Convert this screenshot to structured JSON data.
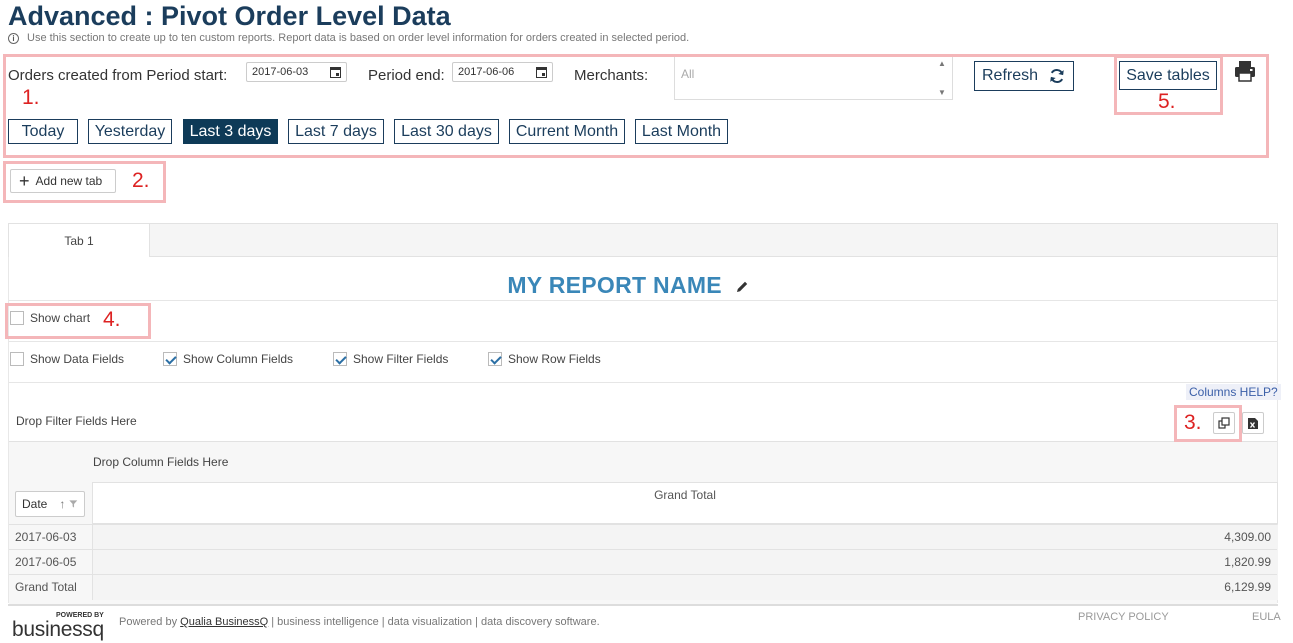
{
  "page": {
    "title": "Advanced : Pivot Order Level Data",
    "subtitle": "Use this section to create up to ten custom reports. Report data is based on order level information for orders created in selected period."
  },
  "filters": {
    "period_start_label": "Orders created from Period start:",
    "period_start_value": "2017-06-03",
    "period_end_label": "Period end:",
    "period_end_value": "2017-06-06",
    "merchants_label": "Merchants:",
    "merchants_value": "All",
    "refresh_label": "Refresh",
    "save_tables_label": "Save tables",
    "quick_ranges": [
      "Today",
      "Yesterday",
      "Last 3 days",
      "Last 7 days",
      "Last 30 days",
      "Current Month",
      "Last Month"
    ],
    "active_range": "Last 3 days"
  },
  "annotations": [
    "1.",
    "2.",
    "3.",
    "4.",
    "5."
  ],
  "tabs": {
    "add_label": "Add new tab",
    "items": [
      "Tab 1"
    ]
  },
  "report": {
    "name": "MY REPORT NAME",
    "show_chart_label": "Show chart",
    "options": [
      {
        "label": "Show Data Fields",
        "checked": false
      },
      {
        "label": "Show Column Fields",
        "checked": true
      },
      {
        "label": "Show Filter Fields",
        "checked": true
      },
      {
        "label": "Show Row Fields",
        "checked": true
      }
    ],
    "columns_help": "Columns HELP?",
    "drop_filter": "Drop Filter Fields Here",
    "drop_column": "Drop Column Fields Here",
    "row_field": "Date",
    "grand_total_header": "Grand Total",
    "rows": [
      {
        "label": "2017-06-03",
        "value": "4,309.00"
      },
      {
        "label": "2017-06-05",
        "value": "1,820.99"
      },
      {
        "label": "Grand Total",
        "value": "6,129.99"
      }
    ]
  },
  "footer": {
    "powered_by_small": "POWERED BY",
    "logo_text": "businessq",
    "powered_prefix": "Powered by",
    "powered_link": "Qualia BusinessQ",
    "powered_suffix": "| business intelligence | data visualization | data discovery software.",
    "privacy": "PRIVACY POLICY",
    "eula": "EULA"
  },
  "colors": {
    "brand": "#1b3d5c",
    "active_button": "#0e3a57",
    "report_name": "#3a87b8",
    "annotation": "#dd2222",
    "annotation_box": "#f4b6b9"
  }
}
